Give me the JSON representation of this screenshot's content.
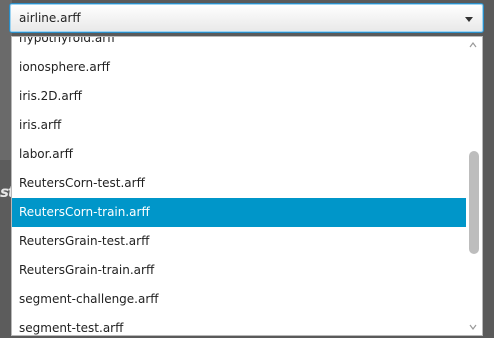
{
  "combo": {
    "selected_value": "airline.arff"
  },
  "background": {
    "fragment_text": "st"
  },
  "dropdown": {
    "items": [
      {
        "label": "hypothyroid.arff"
      },
      {
        "label": "ionosphere.arff"
      },
      {
        "label": "iris.2D.arff"
      },
      {
        "label": "iris.arff"
      },
      {
        "label": "labor.arff"
      },
      {
        "label": "ReutersCorn-test.arff"
      },
      {
        "label": "ReutersCorn-train.arff"
      },
      {
        "label": "ReutersGrain-test.arff"
      },
      {
        "label": "ReutersGrain-train.arff"
      },
      {
        "label": "segment-challenge.arff"
      },
      {
        "label": "segment-test.arff"
      }
    ],
    "selected_index": 6
  },
  "colors": {
    "selection": "#0096c9",
    "focus_border": "#2a8ec8"
  },
  "icons": {
    "combo_arrow": "chevron-down-icon",
    "scroll_up": "scroll-up-icon",
    "scroll_down": "scroll-down-icon"
  }
}
